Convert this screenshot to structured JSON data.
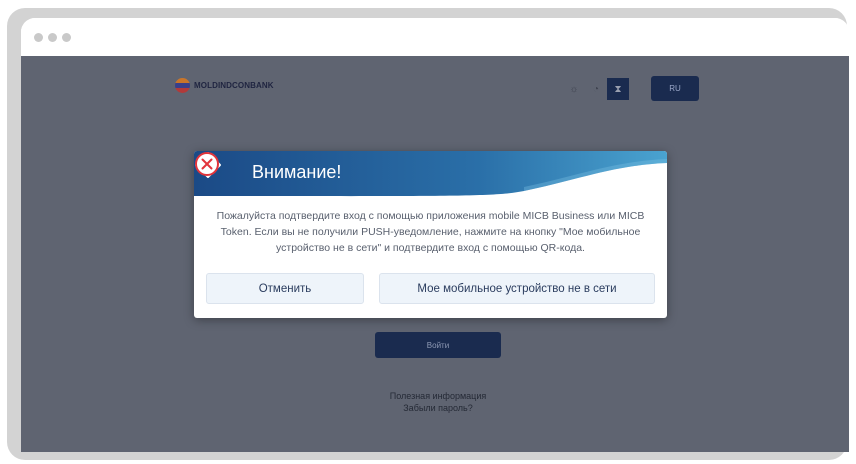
{
  "window": {
    "controls": [
      "close",
      "minimize",
      "maximize"
    ]
  },
  "page": {
    "logo_text": "MOLDINDCONBANK",
    "theme_icons": [
      "sun-icon",
      "moon-icon",
      "contrast-icon"
    ],
    "language": "RU",
    "login_button": "Войти",
    "link_useful_info": "Полезная информация",
    "link_forgot_password": "Забыли пароль?"
  },
  "modal": {
    "title": "Внимание!",
    "message": "Пожалуйста подтвердите вход с помощью приложения mobile MICB Business или MICB Token. Если вы не получили PUSH-уведомление, нажмите на кнопку \"Мое мобильное устройство не в сети\" и подтвердите вход с помощью QR-кода.",
    "cancel_button": "Отменить",
    "offline_button": "Мое мобильное устройство не в сети",
    "icons": {
      "warning": "warning-diamond-icon",
      "close": "close-circle-icon"
    }
  },
  "colors": {
    "overlay": "#5f6471",
    "header_dark": "#1e4f8a",
    "header_light": "#3f93c4",
    "primary": "#1a2b4f",
    "close_red": "#e2343b"
  }
}
